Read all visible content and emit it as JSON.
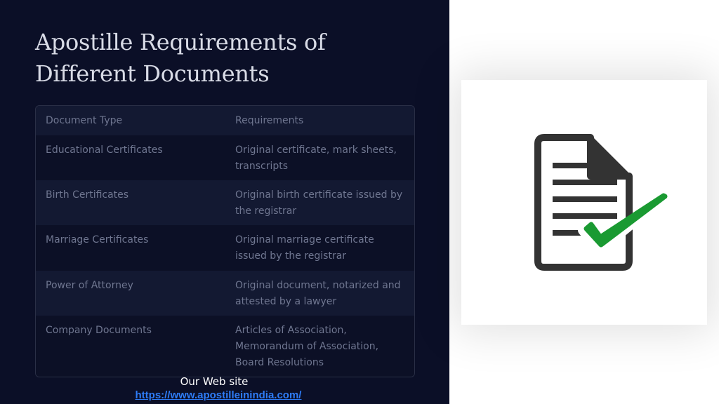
{
  "slide": {
    "title": "Apostille Requirements of Different Documents",
    "table": {
      "headers": [
        "Document Type",
        "Requirements"
      ],
      "rows": [
        [
          "Educational Certificates",
          "Original certificate, mark sheets, transcripts"
        ],
        [
          "Birth Certificates",
          "Original birth certificate issued by the registrar"
        ],
        [
          "Marriage Certificates",
          "Original marriage certificate issued by the registrar"
        ],
        [
          "Power of Attorney",
          "Original document, notarized and attested by a lawyer"
        ],
        [
          "Company Documents",
          "Articles of Association, Memorandum of Association, Board Resolutions"
        ]
      ]
    },
    "website": {
      "label": "Our Web site",
      "url": "https://www.apostilleinindia.com/"
    },
    "image": {
      "icon": "document-checkmark-icon"
    }
  },
  "colors": {
    "panel_background": "#0b0f27",
    "title_text": "#d8dbe6",
    "table_text": "#6f7690",
    "link": "#2e7cf6",
    "check_green": "#1a9a32",
    "document_dark": "#333333"
  }
}
